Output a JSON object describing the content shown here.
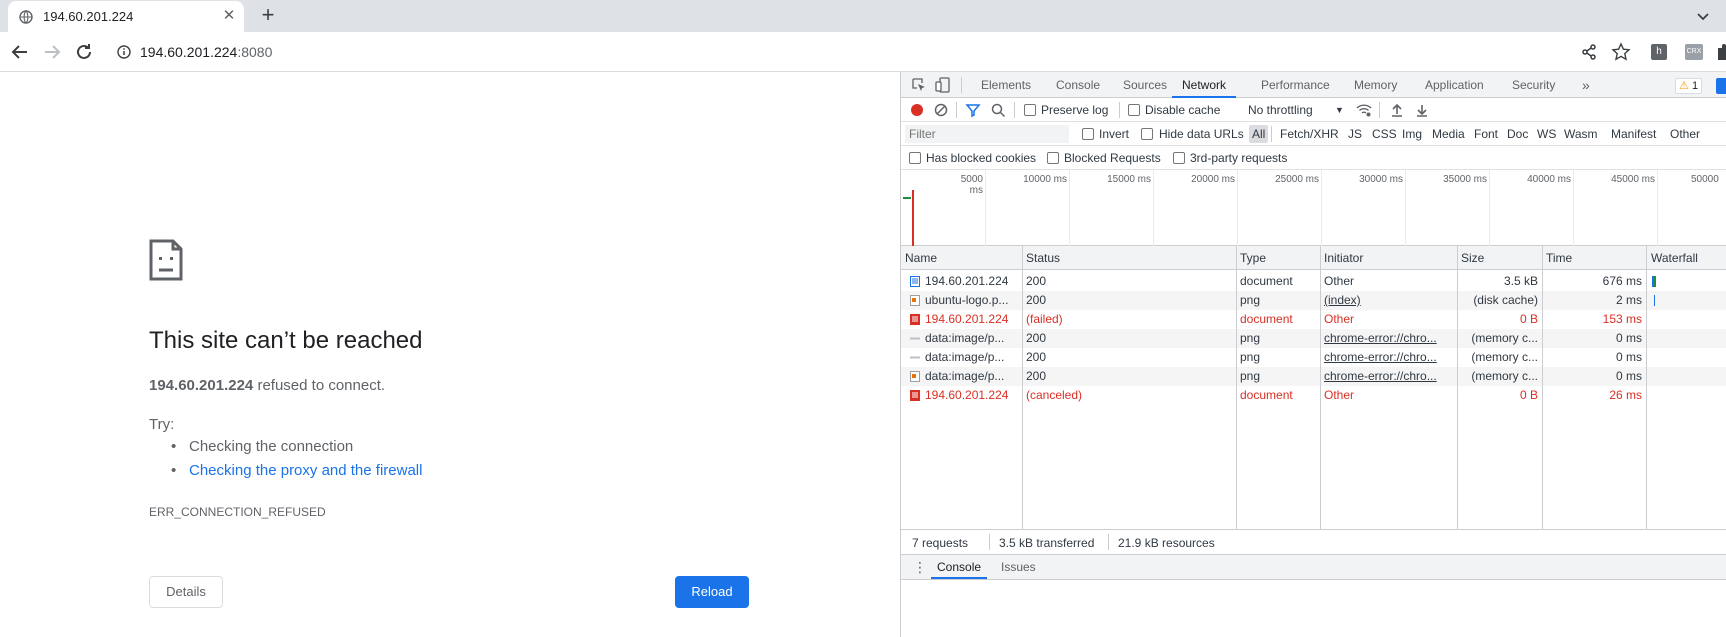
{
  "browser": {
    "tab_title": "194.60.201.224",
    "url_host": "194.60.201.224",
    "url_port": ":8080"
  },
  "error_page": {
    "title": "This site can’t be reached",
    "host": "194.60.201.224",
    "host_suffix": " refused to connect.",
    "try_label": "Try:",
    "suggestions": [
      "Checking the connection",
      "Checking the proxy and the firewall"
    ],
    "error_code": "ERR_CONNECTION_REFUSED",
    "details_button": "Details",
    "reload_button": "Reload",
    "link_color": "#1a73e8"
  },
  "devtools": {
    "tabs": [
      "Elements",
      "Console",
      "Sources",
      "Network",
      "Performance",
      "Memory",
      "Application",
      "Security"
    ],
    "active_tab": "Network",
    "more_tabs": "»",
    "warning_count": "1",
    "network": {
      "preserve_log": "Preserve log",
      "disable_cache": "Disable cache",
      "throttling": "No throttling",
      "filter_placeholder": "Filter",
      "invert": "Invert",
      "hide_data_urls": "Hide data URLs",
      "types": [
        "All",
        "Fetch/XHR",
        "JS",
        "CSS",
        "Img",
        "Media",
        "Font",
        "Doc",
        "WS",
        "Wasm",
        "Manifest",
        "Other"
      ],
      "active_type": "All",
      "has_blocked_cookies": "Has blocked cookies",
      "blocked_requests": "Blocked Requests",
      "third_party": "3rd-party requests",
      "overview_ticks": [
        "5000 ms",
        "10000 ms",
        "15000 ms",
        "20000 ms",
        "25000 ms",
        "30000 ms",
        "35000 ms",
        "40000 ms",
        "45000 ms",
        "50000"
      ],
      "columns": [
        "Name",
        "Status",
        "Type",
        "Initiator",
        "Size",
        "Time",
        "Waterfall"
      ],
      "rows": [
        {
          "name": "194.60.201.224",
          "status": "200",
          "type": "document",
          "initiator": "Other",
          "size": "3.5 kB",
          "time": "676 ms",
          "icon": "document-icon",
          "error": false,
          "link": false
        },
        {
          "name": "ubuntu-logo.p...",
          "status": "200",
          "type": "png",
          "initiator": "(index)",
          "size": "(disk cache)",
          "time": "2 ms",
          "icon": "image-icon",
          "error": false,
          "link": true
        },
        {
          "name": "194.60.201.224",
          "status": "(failed)",
          "type": "document",
          "initiator": "Other",
          "size": "0 B",
          "time": "153 ms",
          "icon": "document-error-icon",
          "error": true,
          "link": false
        },
        {
          "name": "data:image/p...",
          "status": "200",
          "type": "png",
          "initiator": "chrome-error://chro...",
          "size": "(memory c...",
          "time": "0 ms",
          "icon": "data-image-icon",
          "error": false,
          "link": true
        },
        {
          "name": "data:image/p...",
          "status": "200",
          "type": "png",
          "initiator": "chrome-error://chro...",
          "size": "(memory c...",
          "time": "0 ms",
          "icon": "data-image-icon",
          "error": false,
          "link": true
        },
        {
          "name": "data:image/p...",
          "status": "200",
          "type": "png",
          "initiator": "chrome-error://chro...",
          "size": "(memory c...",
          "time": "0 ms",
          "icon": "image-icon",
          "error": false,
          "link": true
        },
        {
          "name": "194.60.201.224",
          "status": "(canceled)",
          "type": "document",
          "initiator": "Other",
          "size": "0 B",
          "time": "26 ms",
          "icon": "document-error-icon",
          "error": true,
          "link": false
        }
      ],
      "summary": {
        "requests": "7 requests",
        "transferred": "3.5 kB transferred",
        "resources": "21.9 kB resources"
      }
    },
    "drawer_tabs": [
      "Console",
      "Issues"
    ],
    "drawer_active": "Console"
  }
}
